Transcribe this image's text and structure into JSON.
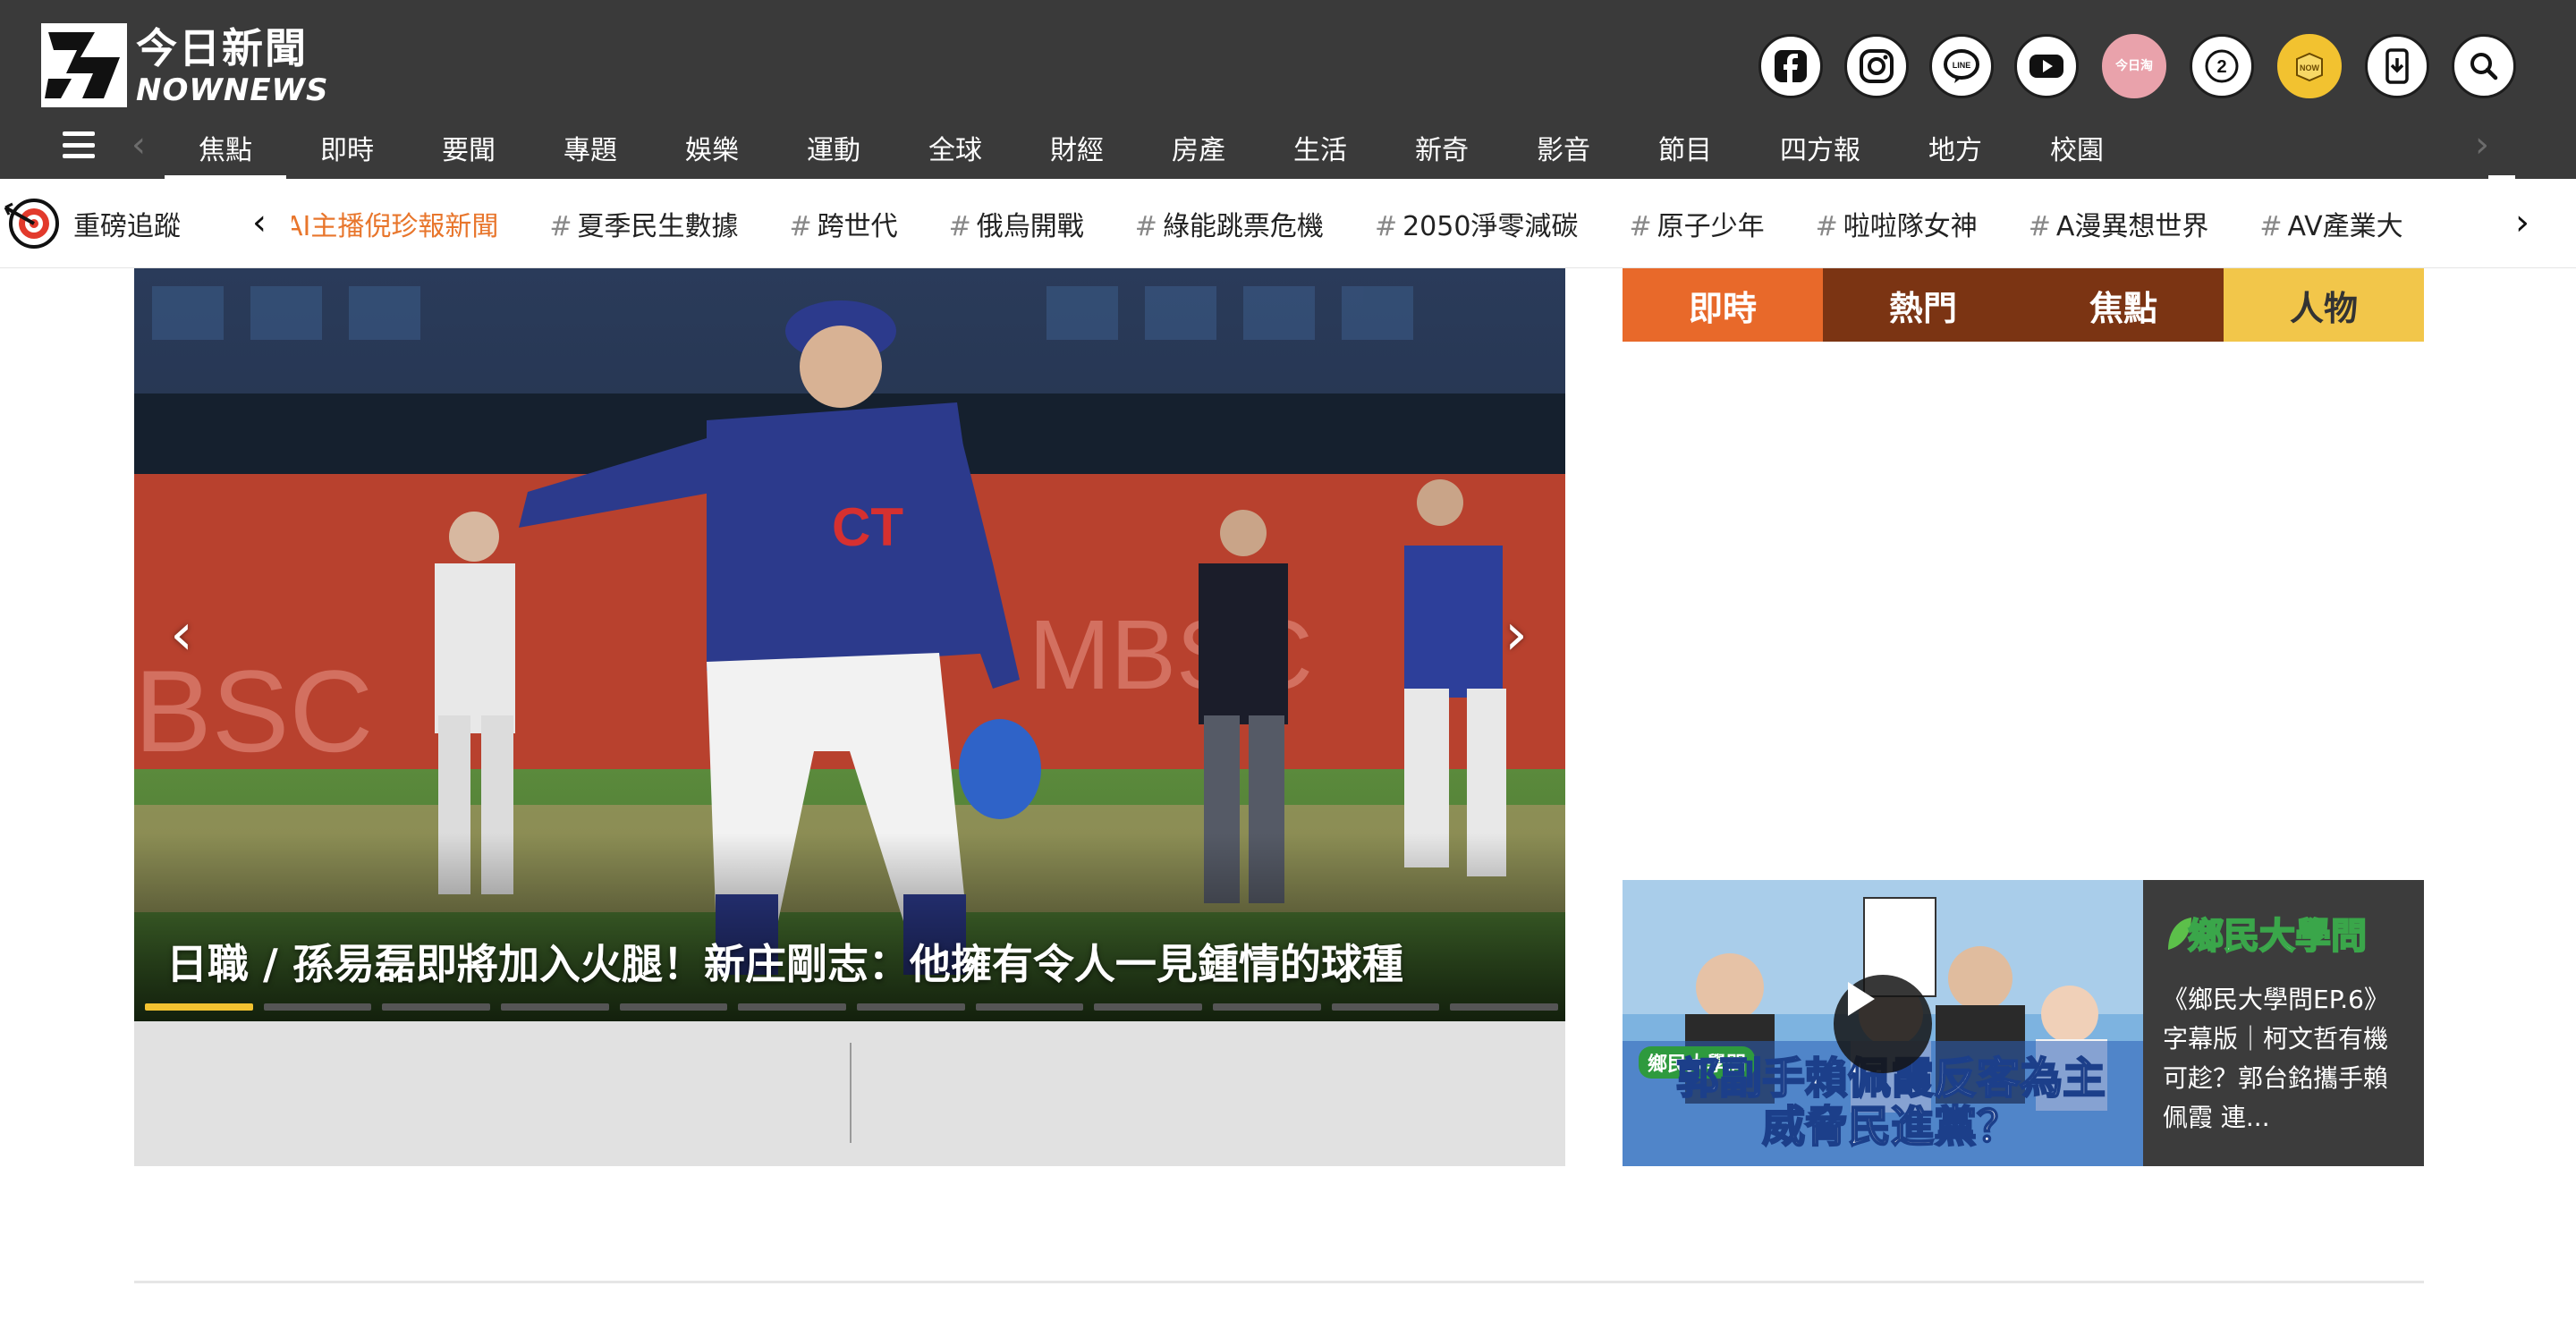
{
  "header": {
    "logo": {
      "zh": "今日新聞",
      "en": "NOWNEWS"
    },
    "social": [
      {
        "icon": "facebook-icon"
      },
      {
        "icon": "instagram-icon"
      },
      {
        "icon": "line-icon"
      },
      {
        "icon": "youtube-icon"
      },
      {
        "icon": "shop-icon",
        "text": "今日淘"
      },
      {
        "icon": "nownews-2-icon",
        "text": "NOW"
      },
      {
        "icon": "now-box-icon",
        "text": "NOW"
      },
      {
        "icon": "mobile-download-icon"
      },
      {
        "icon": "search-icon"
      }
    ],
    "accent_colors": {
      "pink": "#e9a2ab",
      "yellow": "#f2c230"
    }
  },
  "nav": {
    "items": [
      "焦點",
      "即時",
      "要聞",
      "專題",
      "娛樂",
      "運動",
      "全球",
      "財經",
      "房產",
      "生活",
      "新奇",
      "影音",
      "節目",
      "四方報",
      "地方",
      "校園"
    ],
    "active_index": 0
  },
  "tagbar": {
    "title": "重磅追蹤",
    "tags": [
      "AI主播倪珍報新聞",
      "夏季民生數據",
      "跨世代",
      "俄烏開戰",
      "綠能跳票危機",
      "2050淨零減碳",
      "原子少年",
      "啦啦隊女神",
      "A漫異想世界",
      "AV產業大"
    ],
    "current_index": 0
  },
  "carousel": {
    "caption": "日職 / 孫易磊即將加入火腿！新庄剛志：他擁有令人一見鍾情的球種",
    "slide_count": 12,
    "active_slide": 0
  },
  "tabs": [
    {
      "label": "即時",
      "color": "#e8692a"
    },
    {
      "label": "熱門",
      "color": "#7b3413"
    },
    {
      "label": "焦點",
      "color": "#7b3413"
    },
    {
      "label": "人物",
      "color": "#f2c64a",
      "text_color": "#333333"
    }
  ],
  "video": {
    "brand": "鄉民大學問",
    "thumb_badge": "鄉民大學問",
    "thumb_line1": "郭副手賴佩霞反客為主",
    "thumb_line2": "威脅民進黨？",
    "description": "《鄉民大學問EP.6》字幕版｜柯文哲有機可趁？郭台銘攜手賴佩霞 連..."
  }
}
